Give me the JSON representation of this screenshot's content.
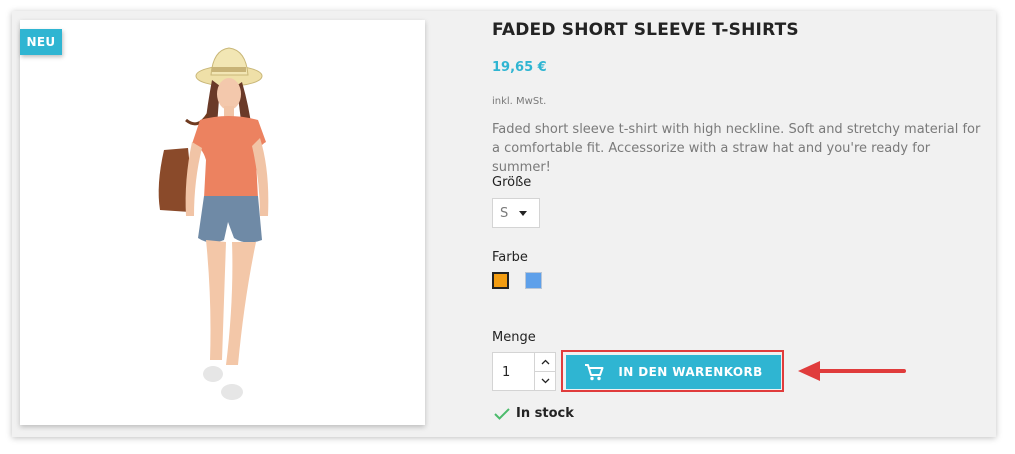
{
  "product": {
    "badge": "NEU",
    "title": "FADED SHORT SLEEVE T-SHIRTS",
    "price": "19,65 €",
    "tax_note": "inkl. MwSt.",
    "description": "Faded short sleeve t-shirt with high neckline. Soft and stretchy material for a comfortable fit. Accessorize with a straw hat and you're ready for summer!"
  },
  "options": {
    "size_label": "Größe",
    "size_value": "S",
    "color_label": "Farbe",
    "colors": [
      {
        "name": "orange",
        "hex": "#f39d12",
        "selected": true
      },
      {
        "name": "blue",
        "hex": "#5ea0ea",
        "selected": false
      }
    ]
  },
  "purchase": {
    "quantity_label": "Menge",
    "quantity_value": "1",
    "add_to_cart_label": "IN DEN WARENKORB",
    "stock_label": "In stock"
  },
  "colors": {
    "accent": "#2fb5d2",
    "highlight": "#e03c3c",
    "stock_check": "#4cbb6c",
    "card_bg": "#f1f1f1"
  },
  "icons": {
    "cart": "shopping-cart-icon",
    "check": "check-icon",
    "caret": "caret-down-icon"
  }
}
